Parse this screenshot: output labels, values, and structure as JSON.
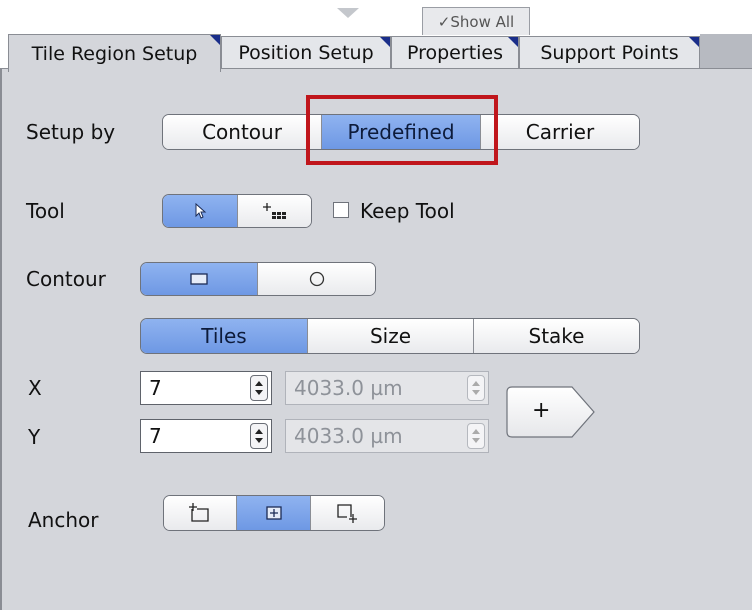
{
  "top_toggle": {
    "label": "✓Show All"
  },
  "tabs": [
    {
      "label": "Tile Region Setup",
      "active": true
    },
    {
      "label": "Position Setup",
      "active": false
    },
    {
      "label": "Properties",
      "active": false
    },
    {
      "label": "Support Points",
      "active": false
    }
  ],
  "setup_by": {
    "label": "Setup by",
    "options": [
      "Contour",
      "Predefined",
      "Carrier"
    ],
    "selected": "Predefined"
  },
  "tool": {
    "label": "Tool",
    "icons": [
      "pointer-icon",
      "tile-grid-add-icon"
    ],
    "selected": "pointer-icon",
    "keep_tool": {
      "label": "Keep Tool",
      "checked": false
    }
  },
  "contour": {
    "label": "Contour",
    "icons": [
      "rectangle-icon",
      "circle-icon"
    ],
    "selected": "rectangle-icon"
  },
  "mode": {
    "options": [
      "Tiles",
      "Size",
      "Stake"
    ],
    "selected": "Tiles"
  },
  "x": {
    "label": "X",
    "tiles": "7",
    "size": "4033.0 µm"
  },
  "y": {
    "label": "Y",
    "tiles": "7",
    "size": "4033.0 µm"
  },
  "add_button": {
    "label": "+"
  },
  "anchor": {
    "label": "Anchor",
    "icons": [
      "anchor-top-left-icon",
      "anchor-center-icon",
      "anchor-bottom-right-icon"
    ],
    "selected": "anchor-center-icon"
  },
  "colors": {
    "selected_fill": "#7aa3ea",
    "panel_bg": "#d4d6db",
    "highlight_border": "#c0161c",
    "tab_corner": "#1a2e8a"
  }
}
